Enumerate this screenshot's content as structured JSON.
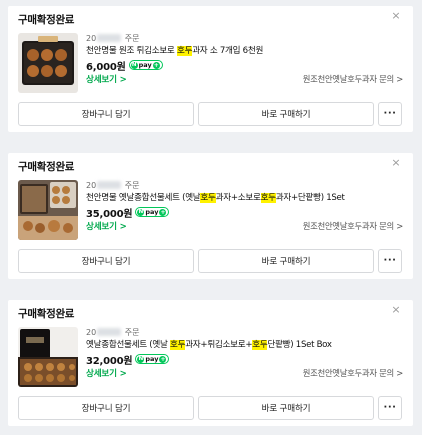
{
  "orders": [
    {
      "status": "구매확정완료",
      "date_prefix": "20",
      "date_suffix": "주문",
      "name_parts": [
        {
          "text": "천안명물 원조 튀김소보로 ",
          "hl": false
        },
        {
          "text": "호두",
          "hl": true
        },
        {
          "text": "과자 소 7개입 6천원",
          "hl": false
        }
      ],
      "price": "6,000원",
      "detail_label": "상세보기 >",
      "seller_label": "원조천안옛날호두과자 문의 >",
      "cart_label": "장바구니 담기",
      "buy_label": "바로 구매하기",
      "more_label": "···",
      "close_label": "×"
    },
    {
      "status": "구매확정완료",
      "date_prefix": "20",
      "date_suffix": "주문",
      "name_parts": [
        {
          "text": "천안명물 옛날종합선물세트 (옛날",
          "hl": false
        },
        {
          "text": "호두",
          "hl": true
        },
        {
          "text": "과자+소보로",
          "hl": false
        },
        {
          "text": "호두",
          "hl": true
        },
        {
          "text": "과자+단팥빵) 1Set",
          "hl": false
        }
      ],
      "price": "35,000원",
      "detail_label": "상세보기 >",
      "seller_label": "원조천안옛날호두과자 문의 >",
      "cart_label": "장바구니 담기",
      "buy_label": "바로 구매하기",
      "more_label": "···",
      "close_label": "×"
    },
    {
      "status": "구매확정완료",
      "date_prefix": "20",
      "date_suffix": "주문",
      "name_parts": [
        {
          "text": "옛날종합선물세트 (옛날 ",
          "hl": false
        },
        {
          "text": "호두",
          "hl": true
        },
        {
          "text": "과자+튀김소보로+",
          "hl": false
        },
        {
          "text": "호두",
          "hl": true
        },
        {
          "text": "단팥빵) 1Set Box",
          "hl": false
        }
      ],
      "price": "32,000원",
      "detail_label": "상세보기 >",
      "seller_label": "원조천안옛날호두과자 문의 >",
      "cart_label": "장바구니 담기",
      "buy_label": "바로 구매하기",
      "more_label": "···",
      "close_label": "×"
    }
  ],
  "npay": {
    "n": "N",
    "text": "pay",
    "plus": "+"
  },
  "colors": {
    "accent": "#03c75a",
    "detail": "#03a94e",
    "highlight": "#fff200",
    "background": "#eef0f3"
  },
  "icons": {
    "close": "close-icon",
    "more": "more-icon",
    "npay": "npay-plus-icon",
    "chevron": "chevron-right-icon"
  }
}
